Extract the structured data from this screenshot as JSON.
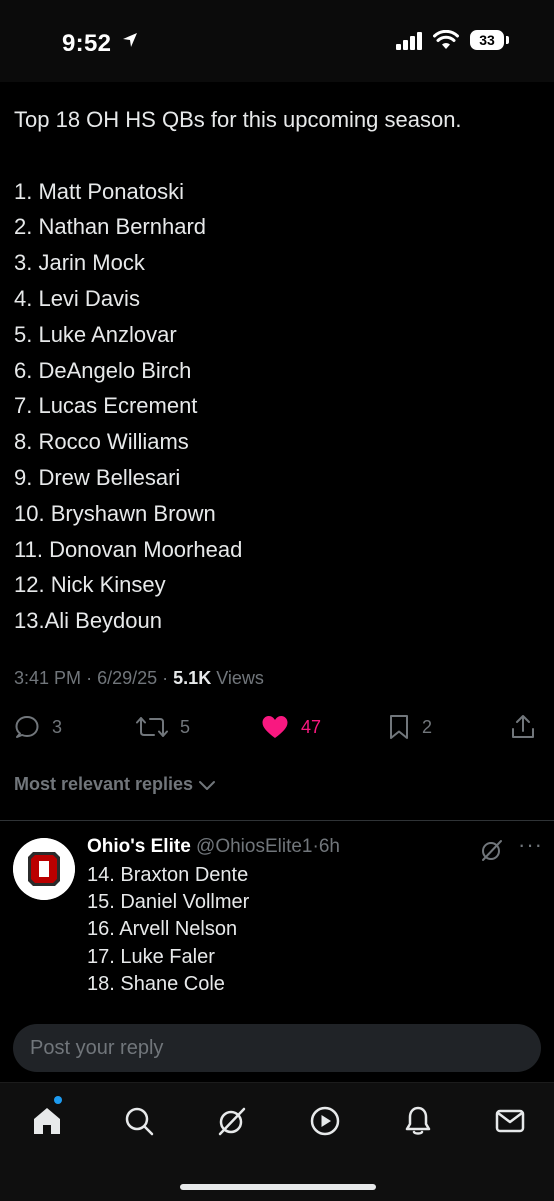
{
  "status_bar": {
    "time": "9:52",
    "battery": "33"
  },
  "post": {
    "intro": "Top 18 OH HS QBs for this upcoming season.",
    "list": [
      "1. Matt Ponatoski",
      "2. Nathan Bernhard",
      "3. Jarin Mock",
      "4. Levi Davis",
      "5. Luke Anzlovar",
      "6. DeAngelo Birch",
      "7. Lucas Ecrement",
      "8. Rocco Williams",
      "9. Drew Bellesari",
      "10. Bryshawn Brown",
      "11. Donovan Moorhead",
      "12. Nick Kinsey",
      "13.Ali Beydoun"
    ],
    "meta": {
      "time": "3:41 PM",
      "sep1": "·",
      "date": "6/29/25",
      "sep2": "·",
      "views_count": "5.1K",
      "views_label": "Views"
    },
    "actions": {
      "replies": "3",
      "reposts": "5",
      "likes": "47",
      "bookmarks": "2"
    }
  },
  "replies_filter": "Most relevant replies",
  "reply": {
    "name": "Ohio's Elite",
    "handle": "@OhiosElite1",
    "sep": "·",
    "time": "6h",
    "lines": [
      "14. Braxton Dente",
      "15. Daniel Vollmer",
      "16. Arvell Nelson",
      "17. Luke Faler",
      "18. Shane Cole"
    ]
  },
  "composer": {
    "placeholder": "Post your reply"
  },
  "colors": {
    "accent": "#1d9bf0",
    "like": "#f91880",
    "muted": "#71767b",
    "text": "#e7e9ea"
  },
  "tab_icons": [
    "home-icon",
    "search-icon",
    "grok-icon",
    "video-icon",
    "notifications-icon",
    "messages-icon"
  ]
}
